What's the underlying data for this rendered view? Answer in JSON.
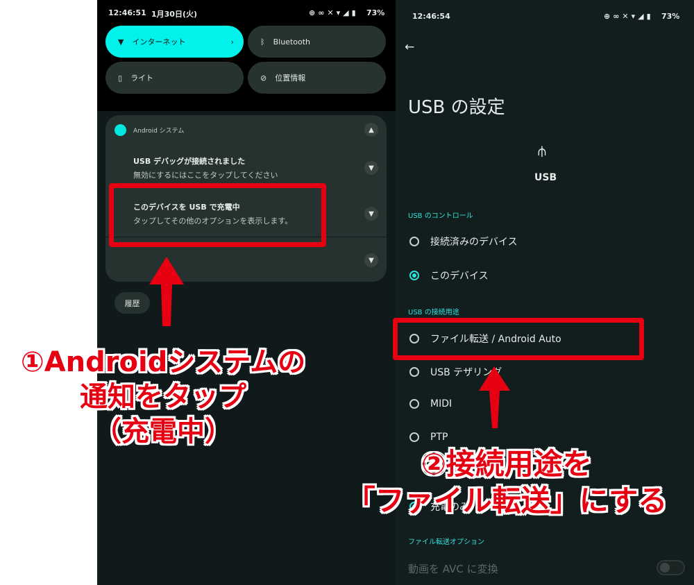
{
  "left_screen": {
    "status": {
      "time": "12:46:51",
      "date": "1月30日(火)",
      "battery": "73%"
    },
    "tiles": [
      {
        "label": "インターネット",
        "icon": "wifi-icon",
        "active": true
      },
      {
        "label": "Bluetooth",
        "icon": "bluetooth-icon",
        "active": false
      },
      {
        "label": "ライト",
        "icon": "flashlight-icon",
        "active": false
      },
      {
        "label": "位置情報",
        "icon": "location-off-icon",
        "active": false
      }
    ],
    "notification": {
      "app": "Android システム",
      "items": [
        {
          "title": "USB デバッグが接続されました",
          "text": "無効にするにはここをタップしてください"
        },
        {
          "title": "このデバイスを USB で充電中",
          "text": "タップしてその他のオプションを表示します。"
        }
      ]
    },
    "history_button": "履歴"
  },
  "right_screen": {
    "status": {
      "time": "12:46:54",
      "battery": "73%"
    },
    "title": "USB の設定",
    "usb_label": "USB",
    "control_section": "USB のコントロール",
    "control_options": [
      {
        "label": "接続済みのデバイス",
        "selected": false
      },
      {
        "label": "このデバイス",
        "selected": true
      }
    ],
    "purpose_section": "USB の接続用途",
    "purpose_options": [
      {
        "label": "ファイル転送 / Android Auto",
        "selected": false
      },
      {
        "label": "USB テザリング",
        "selected": false
      },
      {
        "label": "MIDI",
        "selected": false
      },
      {
        "label": "PTP",
        "selected": false
      },
      {
        "label": "充電のみ",
        "selected": true
      }
    ],
    "file_options_section": "ファイル転送オプション",
    "avc_toggle": {
      "label": "動画を AVC に変換",
      "on": false
    }
  },
  "annotations": {
    "step1": [
      "①Androidシステムの",
      "通知をタップ",
      "（充電中）"
    ],
    "step2": [
      "②接続用途を",
      "「ファイル転送」にする"
    ],
    "accent": "#e60012"
  }
}
